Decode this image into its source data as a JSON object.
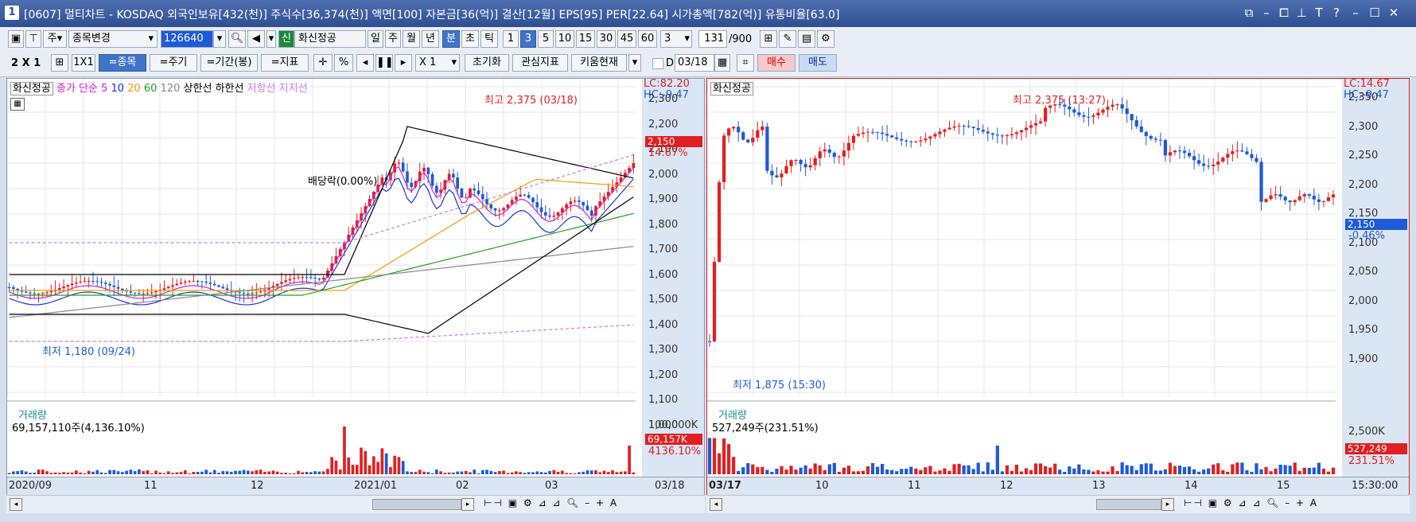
{
  "title": {
    "number": "1",
    "text": "[0607] 멀티차트 - KOSDAQ 외국인보유[432(천)] 주식수[36,374(천)] 액면[100] 자본금[36(억)] 결산[12월] EPS[95] PER[22.64] 시가총액[782(억)] 유통비율[63.0]"
  },
  "toolbar1": {
    "code_type": "주",
    "stock_change": "종목변경",
    "code": "126640",
    "sin_badge": "신",
    "stock_name": "화신정공",
    "periods": [
      "일",
      "주",
      "월",
      "년",
      "분",
      "초",
      "틱"
    ],
    "minutes": [
      "1",
      "3",
      "5",
      "10",
      "15",
      "30",
      "45",
      "60"
    ],
    "interval": "3",
    "count": "131",
    "count_total": "/900"
  },
  "toolbar2": {
    "grid": "2 X 1",
    "grid_1x1": "1X1",
    "btn_stock": "=종목",
    "btn_period": "=주기",
    "btn_range": "=기간(봉)",
    "btn_indicator": "=지표",
    "pct": "%",
    "scale": "X 1",
    "reset": "초기화",
    "watch_indicator": "관심지표",
    "kiwoom_now": "키움현재",
    "d_label": "D",
    "date": "03/18",
    "buy": "매수",
    "sell": "매도"
  },
  "left": {
    "stock": "화신정공",
    "legend": {
      "close_simple": "종가 단순",
      "ma5": "5",
      "ma10": "10",
      "ma20": "20",
      "ma60": "60",
      "ma120": "120",
      "upper": "상한선",
      "lower": "하한선",
      "resistance": "저항선",
      "support": "지지선"
    },
    "lc": "LC:82.20",
    "hc": "HC:-9.47",
    "last_price": "2,150",
    "last_pct": "14.67%",
    "high_label": "최고 2,375 (03/18)",
    "low_label": "최저 1,180 (09/24)",
    "dividend": "배당락(0.00%)",
    "yticks": [
      "2,300",
      "2,200",
      "2,100",
      "2,000",
      "1,900",
      "1,800",
      "1,700",
      "1,600",
      "1,500",
      "1,400",
      "1,300",
      "1,200",
      "1,100",
      "1,000"
    ],
    "volume_title": "거래량",
    "volume_value": "69,157,110주(4,136.10%)",
    "volume_axis": "100,000K",
    "volume_last": "69,157K",
    "volume_pct": "4136.10%",
    "xlabels": [
      "2020/09",
      "11",
      "12",
      "2021/01",
      "02",
      "03",
      "03/18"
    ]
  },
  "right": {
    "stock": "화신정공",
    "lc": "LC:14.67",
    "hc": "HC:-9.47",
    "last_price": "2,150",
    "last_pct": "-0.46%",
    "high_label": "최고 2,375 (13:27)",
    "low_label": "최저 1,875 (15:30)",
    "yticks": [
      "2,350",
      "2,300",
      "2,250",
      "2,200",
      "2,150",
      "2,100",
      "2,050",
      "2,000",
      "1,950",
      "1,900"
    ],
    "volume_title": "거래량",
    "volume_value": "527,249주(231.51%)",
    "volume_axis": "2,500K",
    "volume_last": "527,249",
    "volume_pct": "231.51%",
    "xlabels": [
      "03/17",
      "10",
      "11",
      "12",
      "13",
      "14",
      "15",
      "15:30:00"
    ]
  },
  "colors": {
    "up": "#e02020",
    "down": "#1f5ad8",
    "ma5": "#d020d0",
    "ma10": "#2030e0",
    "ma20": "#f0a000",
    "ma60": "#20a020",
    "ma120": "#888888",
    "band": "#000000",
    "env": "#c080f0"
  }
}
